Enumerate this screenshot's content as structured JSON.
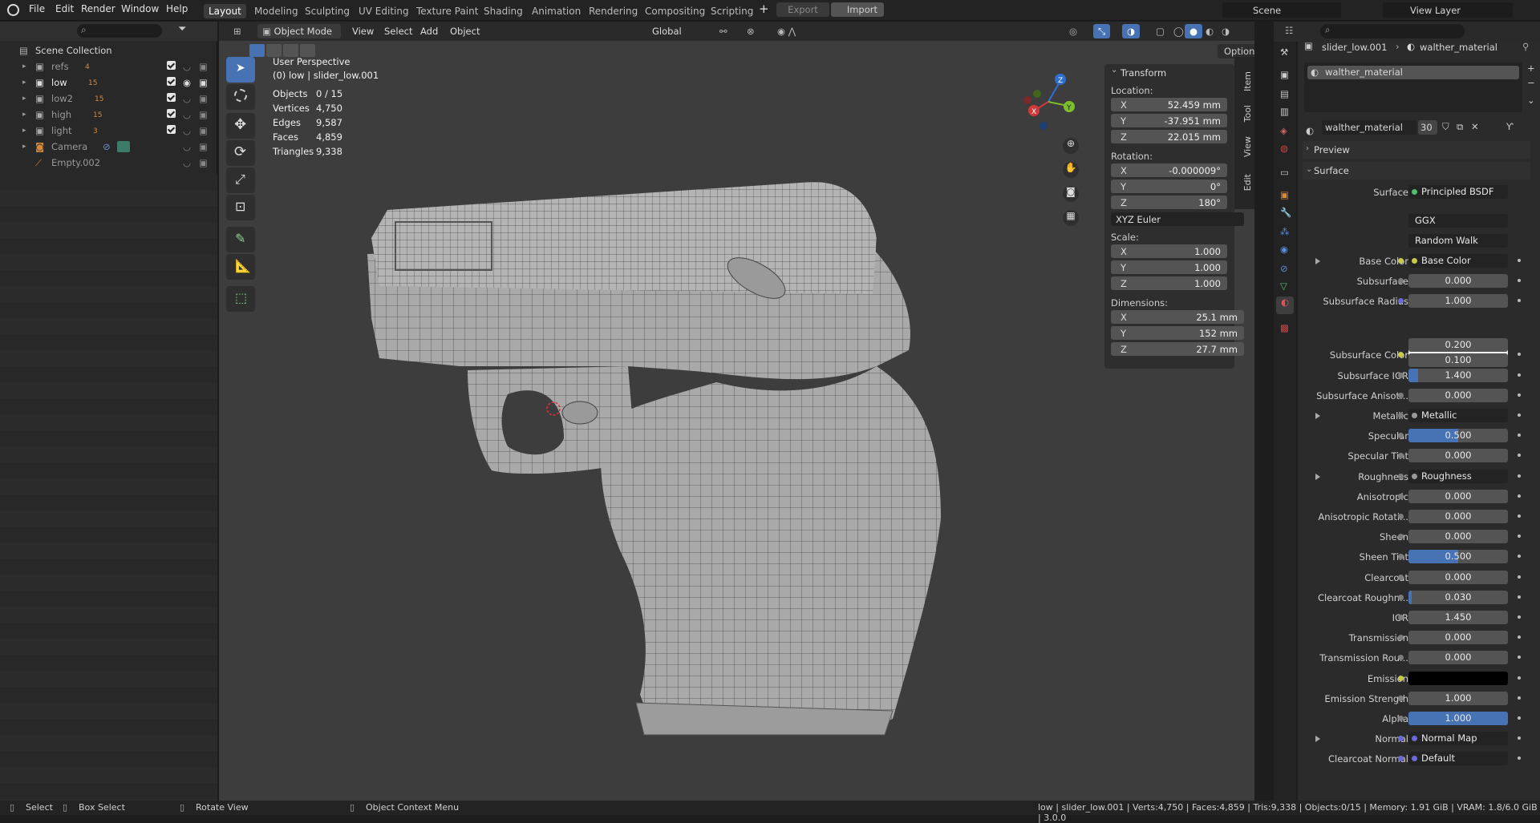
{
  "topbar": {
    "menus": [
      "File",
      "Edit",
      "Render",
      "Window",
      "Help"
    ],
    "workspaces": [
      "Layout",
      "Modeling",
      "Sculpting",
      "UV Editing",
      "Texture Paint",
      "Shading",
      "Animation",
      "Rendering",
      "Compositing",
      "Scripting"
    ],
    "active_workspace": "Layout",
    "export_label": "Export",
    "import_label": "Import",
    "scene": "Scene",
    "view_layer": "View Layer"
  },
  "outliner": {
    "root": "Scene Collection",
    "items": [
      {
        "name": "refs",
        "count": "4"
      },
      {
        "name": "low",
        "count": "15"
      },
      {
        "name": "low2",
        "count": "15"
      },
      {
        "name": "high",
        "count": "15"
      },
      {
        "name": "light",
        "count": "3"
      },
      {
        "name": "Camera",
        "count": ""
      },
      {
        "name": "Empty.002",
        "count": ""
      }
    ]
  },
  "viewport": {
    "mode": "Object Mode",
    "menus": [
      "View",
      "Select",
      "Add",
      "Object"
    ],
    "orientation": "Global",
    "options": "Options",
    "perspective": "User Perspective",
    "active": "(0) low | slider_low.001",
    "stats": [
      {
        "label": "Objects",
        "value": "0 / 15"
      },
      {
        "label": "Vertices",
        "value": "4,750"
      },
      {
        "label": "Edges",
        "value": "9,587"
      },
      {
        "label": "Faces",
        "value": "4,859"
      },
      {
        "label": "Triangles",
        "value": "9,338"
      }
    ],
    "gizmo": {
      "x": "X",
      "y": "Y",
      "z": "Z"
    }
  },
  "transform": {
    "title": "Transform",
    "location_label": "Location:",
    "location": [
      "52.459 mm",
      "-37.951 mm",
      "22.015 mm"
    ],
    "rotation_label": "Rotation:",
    "rotation": [
      "-0.000009°",
      "0°",
      "180°"
    ],
    "rotation_mode": "XYZ Euler",
    "scale_label": "Scale:",
    "scale": [
      "1.000",
      "1.000",
      "1.000"
    ],
    "dimensions_label": "Dimensions:",
    "dimensions": [
      "25.1 mm",
      "152 mm",
      "27.7 mm"
    ],
    "axes": [
      "X",
      "Y",
      "Z"
    ],
    "side_tabs": [
      "Item",
      "Tool",
      "View",
      "Edit"
    ]
  },
  "properties": {
    "object": "slider_low.001",
    "material": "walther_material",
    "slot": "walther_material",
    "mat_field": "walther_material",
    "users": "30",
    "preview": "Preview",
    "surface_section": "Surface",
    "surface_label": "Surface",
    "surface_value": "Principled BSDF",
    "distribution": "GGX",
    "subsurface_method": "Random Walk",
    "rows": [
      {
        "label": "Base Color",
        "value": "Base Color",
        "type": "link",
        "color": "#c9c948",
        "expand": true
      },
      {
        "label": "Subsurface",
        "value": "0.000",
        "type": "num"
      },
      {
        "label": "Subsurface Radius",
        "value": "1.000",
        "type": "vec",
        "color": "#6b6bd6"
      },
      {
        "label": "Subsurface Color",
        "value": "",
        "type": "color",
        "color": "#c9c948",
        "swatch": "#eeeeee"
      },
      {
        "label": "Subsurface IOR",
        "value": "1.400",
        "type": "num",
        "fill": 0.1
      },
      {
        "label": "Subsurface Anisot...",
        "value": "0.000",
        "type": "num"
      },
      {
        "label": "Metallic",
        "value": "Metallic",
        "type": "link",
        "expand": true
      },
      {
        "label": "Specular",
        "value": "0.500",
        "type": "num",
        "fill": 0.5
      },
      {
        "label": "Specular Tint",
        "value": "0.000",
        "type": "num"
      },
      {
        "label": "Roughness",
        "value": "Roughness",
        "type": "link",
        "expand": true
      },
      {
        "label": "Anisotropic",
        "value": "0.000",
        "type": "num"
      },
      {
        "label": "Anisotropic Rotati...",
        "value": "0.000",
        "type": "num"
      },
      {
        "label": "Sheen",
        "value": "0.000",
        "type": "num"
      },
      {
        "label": "Sheen Tint",
        "value": "0.500",
        "type": "num",
        "fill": 0.5
      },
      {
        "label": "Clearcoat",
        "value": "0.000",
        "type": "num"
      },
      {
        "label": "Clearcoat Roughn...",
        "value": "0.030",
        "type": "num",
        "fill": 0.03
      },
      {
        "label": "IOR",
        "value": "1.450",
        "type": "num"
      },
      {
        "label": "Transmission",
        "value": "0.000",
        "type": "num"
      },
      {
        "label": "Transmission Rou...",
        "value": "0.000",
        "type": "num"
      },
      {
        "label": "Emission",
        "value": "",
        "type": "color",
        "color": "#c9c948",
        "swatch": "#000000"
      },
      {
        "label": "Emission Strength",
        "value": "1.000",
        "type": "num"
      },
      {
        "label": "Alpha",
        "value": "1.000",
        "type": "num",
        "fill": 1.0
      },
      {
        "label": "Normal",
        "value": "Normal Map",
        "type": "link",
        "color": "#6b6bd6",
        "expand": true
      },
      {
        "label": "Clearcoat Normal",
        "value": "Default",
        "type": "link",
        "color": "#6b6bd6"
      }
    ],
    "radius_extra": [
      "0.200",
      "0.100"
    ]
  },
  "statusbar": {
    "select": "Select",
    "box_select": "Box Select",
    "rotate": "Rotate View",
    "context": "Object Context Menu",
    "info": "low | slider_low.001 | Verts:4,750 | Faces:4,859 | Tris:9,338 | Objects:0/15 | Memory: 1.91 GiB | VRAM: 1.8/6.0 GiB | 3.0.0"
  }
}
